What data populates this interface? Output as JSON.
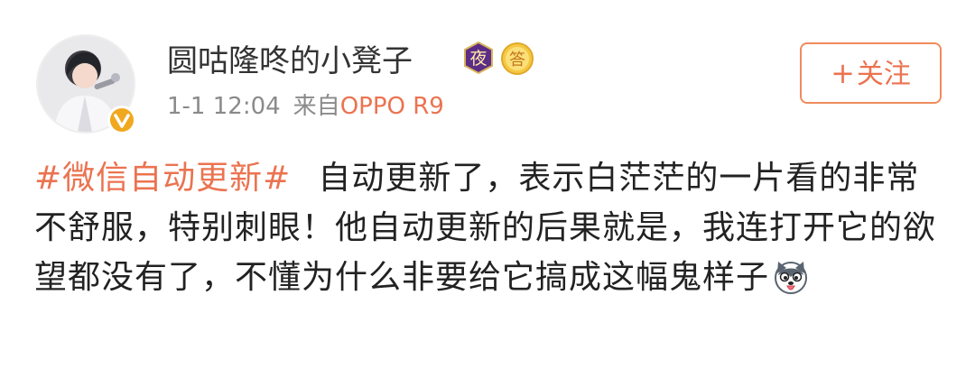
{
  "colors": {
    "accent": "#eb7350",
    "meta_gray": "#8a8a8a",
    "text": "#222222",
    "verified_gold": "#f0a81f"
  },
  "user": {
    "name": "圆咕隆咚的小凳子",
    "avatar_icon": "avatar-photo",
    "verified_icon": "verified-v-icon",
    "badges": [
      {
        "name": "night-badge-icon",
        "glyph": "夜"
      },
      {
        "name": "answer-badge-icon",
        "glyph": "答"
      }
    ]
  },
  "meta": {
    "time": "1-1 12:04",
    "from_label": "来自",
    "device": "OPPO R9"
  },
  "follow": {
    "plus": "+",
    "label": "关注"
  },
  "post": {
    "topic": "#微信自动更新#",
    "body": "自动更新了，表示白茫茫的一片看的非常不舒服，特别刺眼！他自动更新的后果就是，我连打开它的欲望都没有了，不懂为什么非要给它搞成这幅鬼样子",
    "emoji_icon": "husky-dog-emoji-icon"
  }
}
